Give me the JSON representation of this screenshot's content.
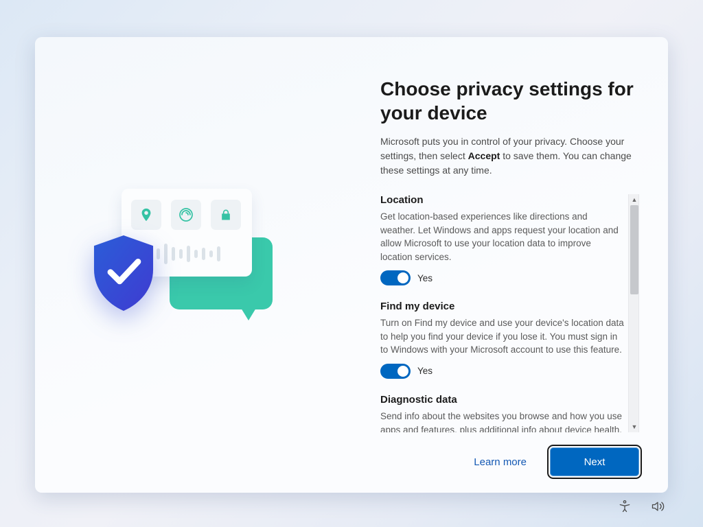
{
  "header": {
    "title": "Choose privacy settings for your device",
    "subtitle_before": "Microsoft puts you in control of your privacy. Choose your settings, then select ",
    "subtitle_bold": "Accept",
    "subtitle_after": " to save them. You can change these settings at any time."
  },
  "settings": [
    {
      "title": "Location",
      "desc": "Get location-based experiences like directions and weather. Let Windows and apps request your location and allow Microsoft to use your location data to improve location services.",
      "toggle_value": "Yes",
      "toggle_on": true
    },
    {
      "title": "Find my device",
      "desc": "Turn on Find my device and use your device's location data to help you find your device if you lose it. You must sign in to Windows with your Microsoft account to use this feature.",
      "toggle_value": "Yes",
      "toggle_on": true
    },
    {
      "title": "Diagnostic data",
      "desc": "Send info about the websites you browse and how you use apps and features, plus additional info about device health, device activity, and enhanced error reporting.",
      "toggle_value": "",
      "toggle_on": true
    }
  ],
  "footer": {
    "learn_more": "Learn more",
    "next": "Next"
  },
  "tray": {
    "accessibility": "Accessibility",
    "volume": "Volume"
  },
  "illustration": {
    "icon1": "location-pin-icon",
    "icon2": "fingerprint-icon",
    "icon3": "lock-icon",
    "shield": "shield-check-icon",
    "speech": "speech-bubble-icon"
  },
  "colors": {
    "accent": "#0067c0",
    "teal": "#3ac9ab",
    "shield1": "#2b5dd8",
    "shield2": "#3f3bd1"
  }
}
